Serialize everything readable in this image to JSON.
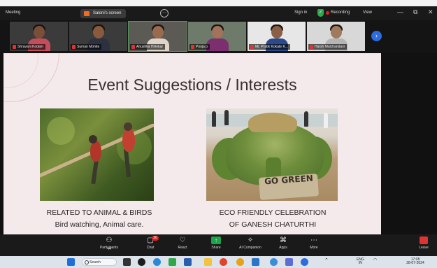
{
  "titlebar": {
    "app": "Meeting",
    "share_label": "Saloni's screen",
    "sign_in": "Sign in",
    "recording": "Recording",
    "view": "View",
    "minimize": "—",
    "restore": "⧉",
    "close": "✕"
  },
  "participants_strip": {
    "tiles": [
      {
        "name": "Shravani Kodam",
        "shirt": "#c44d5a"
      },
      {
        "name": "Suman Mohite",
        "shirt": "#2c3140"
      },
      {
        "name": "Anushka Hirlekar",
        "shirt": "#e0d3c8"
      },
      {
        "name": "Pooja p",
        "shirt": "#7b2f6e"
      },
      {
        "name": "Mr. Pratik Kokate K...",
        "shirt": "#2b4a8a"
      },
      {
        "name": "Harsh Mulchandani",
        "shirt": "#b5b5b5"
      }
    ],
    "next_icon": "›"
  },
  "slide": {
    "title": "Event Suggestions / Interests",
    "left_caption_line1": "RELATED TO ANIMAL & BIRDS",
    "left_caption_line2": "Bird watching, Animal care.",
    "right_caption_line1": "ECO FRIENDLY CELEBRATION",
    "right_caption_line2": "OF GANESH CHATURTHI",
    "sand_art_text": "GO GREEN"
  },
  "toolbar": {
    "participants_label": "Participants",
    "participants_count": "44",
    "chat_label": "Chat",
    "chat_badge": "20",
    "react_label": "React",
    "share_label": "Share",
    "companion_label": "AI Companion",
    "apps_label": "Apps",
    "more_label": "More",
    "leave_label": "Leave"
  },
  "taskbar": {
    "search_label": "Search",
    "lang_line1": "ENG",
    "lang_line2": "IN",
    "time": "17:08",
    "date": "28-07-2024"
  }
}
